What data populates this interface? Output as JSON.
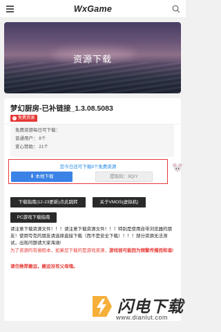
{
  "header": {
    "brand": "WxGame",
    "menu_icon": "menu-icon",
    "search_icon": "search-icon"
  },
  "hero": {
    "title": "资源下载"
  },
  "app": {
    "title": "梦幻厨房-已补链接_1.3.08.5083",
    "badge": "免费资源"
  },
  "info": {
    "lines": [
      "免费资源每日可下载：",
      "普通用户： 8个",
      "爱心赞助： 21个"
    ]
  },
  "download": {
    "notice": "您今日还可下载8个免费资源",
    "local_button": "本地下载",
    "cloud_button": "提取码：8QIY",
    "mascot_icon": "mouse-mascot-icon"
  },
  "actions": {
    "guide_button": "下载指南(12-23更新)点此跳转",
    "vmos_button": "关于VMOS(虚拟机)",
    "pc_button": "PC游戏下载指南"
  },
  "notes": {
    "para1": "请注意下载资源文件！！！请注意下载资源文件！！！特别是使用自带浏览器的朋友！使用夸克的朋友请选择直接下载（而不是安全下载）！！！部分资源无法测试，出现问题请大家海涵!",
    "para2_normal": "为了资源的有偿赔本，如果您下载的是游戏资源，",
    "para2_bold": "游戏很可能因为频繁传播而和谐!",
    "para3": "请勿推荐搬运，搬运没有父母魂。"
  },
  "watermark": {
    "text": "闪电下载",
    "url": "www.dianlut.com",
    "icon": "lightning-logo-icon"
  },
  "colors": {
    "accent_blue": "#3b82e6",
    "accent_red": "#e53935",
    "dark_button": "#2a2a2a"
  }
}
